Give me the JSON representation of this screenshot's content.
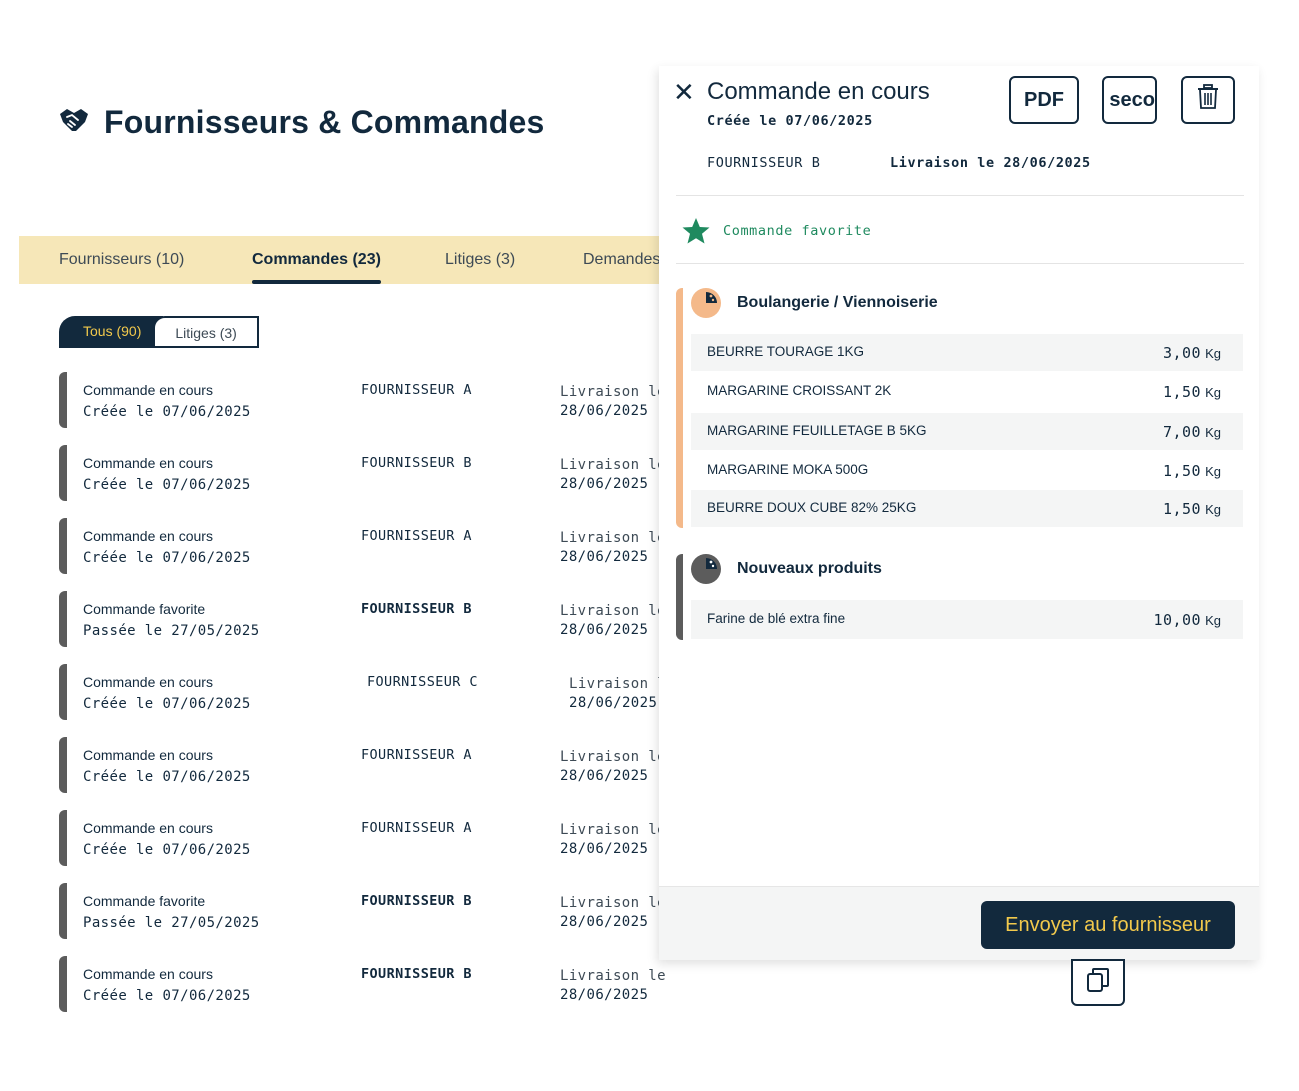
{
  "header": {
    "title": "Fournisseurs & Commandes",
    "icon": "handshake-icon"
  },
  "tabs": [
    {
      "label": "Fournisseurs (10)",
      "active": false
    },
    {
      "label": "Commandes (23)",
      "active": true
    },
    {
      "label": "Litiges (3)",
      "active": false
    },
    {
      "label": "Demandes",
      "active": false
    }
  ],
  "filters": [
    {
      "label": "Tous (90)",
      "active": true
    },
    {
      "label": "Litiges (3)",
      "active": false
    }
  ],
  "orders": [
    {
      "status": "Commande en cours",
      "created": "Créée le 07/06/2025",
      "supplier": "FOURNISSEUR A",
      "delivery_label": "Livraison le",
      "delivery_date": "28/06/2025"
    },
    {
      "status": "Commande en cours",
      "created": "Créée le 07/06/2025",
      "supplier": "FOURNISSEUR B",
      "delivery_label": "Livraison le",
      "delivery_date": "28/06/2025"
    },
    {
      "status": "Commande en cours",
      "created": "Créée le 07/06/2025",
      "supplier": "FOURNISSEUR A",
      "delivery_label": "Livraison le",
      "delivery_date": "28/06/2025"
    },
    {
      "status": "Commande favorite",
      "created": "Passée le 27/05/2025",
      "supplier": "FOURNISSEUR B",
      "delivery_label": "Livraison le",
      "delivery_date": "28/06/2025"
    },
    {
      "status": "Commande en cours",
      "created": "Créée le 07/06/2025",
      "supplier": "FOURNISSEUR C",
      "delivery_label": "Livraison l",
      "delivery_date": "28/06/2025"
    },
    {
      "status": "Commande en cours",
      "created": "Créée le 07/06/2025",
      "supplier": "FOURNISSEUR A",
      "delivery_label": "Livraison le",
      "delivery_date": "28/06/2025"
    },
    {
      "status": "Commande en cours",
      "created": "Créée le 07/06/2025",
      "supplier": "FOURNISSEUR A",
      "delivery_label": "Livraison le",
      "delivery_date": "28/06/2025"
    },
    {
      "status": "Commande favorite",
      "created": "Passée le 27/05/2025",
      "supplier": "FOURNISSEUR B",
      "delivery_label": "Livraison le",
      "delivery_date": "28/06/2025"
    },
    {
      "status": "Commande en cours",
      "created": "Créée le 07/06/2025",
      "supplier": "FOURNISSEUR B",
      "delivery_label": "Livraison le",
      "delivery_date": "28/06/2025"
    }
  ],
  "detail": {
    "title": "Commande en cours",
    "created": "Créée le 07/06/2025",
    "supplier": "FOURNISSEUR B",
    "delivery": "Livraison le 28/06/2025",
    "buttons": {
      "pdf": "PDF",
      "second": "n seco",
      "send": "Envoyer au fournisseur"
    },
    "favorite_label": "Commande favorite",
    "colors": {
      "accent": "#f2c94c",
      "navy": "#12293d",
      "favorite": "#1f8a5f",
      "bakery": "#f4b98a",
      "new": "#5c5c5c"
    },
    "categories": [
      {
        "name": "Boulangerie / Viennoiserie",
        "products": [
          {
            "name": "BEURRE TOURAGE 1KG",
            "qty": "3,00",
            "unit": "Kg"
          },
          {
            "name": "MARGARINE CROISSANT 2K",
            "qty": "1,50",
            "unit": "Kg"
          },
          {
            "name": "MARGARINE FEUILLETAGE B 5KG",
            "qty": "7,00",
            "unit": "Kg"
          },
          {
            "name": "MARGARINE MOKA 500G",
            "qty": "1,50",
            "unit": "Kg"
          },
          {
            "name": "BEURRE DOUX CUBE 82% 25KG",
            "qty": "1,50",
            "unit": "Kg"
          }
        ]
      },
      {
        "name": "Nouveaux produits",
        "products": [
          {
            "name": "Farine de blé extra fine",
            "qty": "10,00",
            "unit": "Kg"
          }
        ]
      }
    ]
  }
}
